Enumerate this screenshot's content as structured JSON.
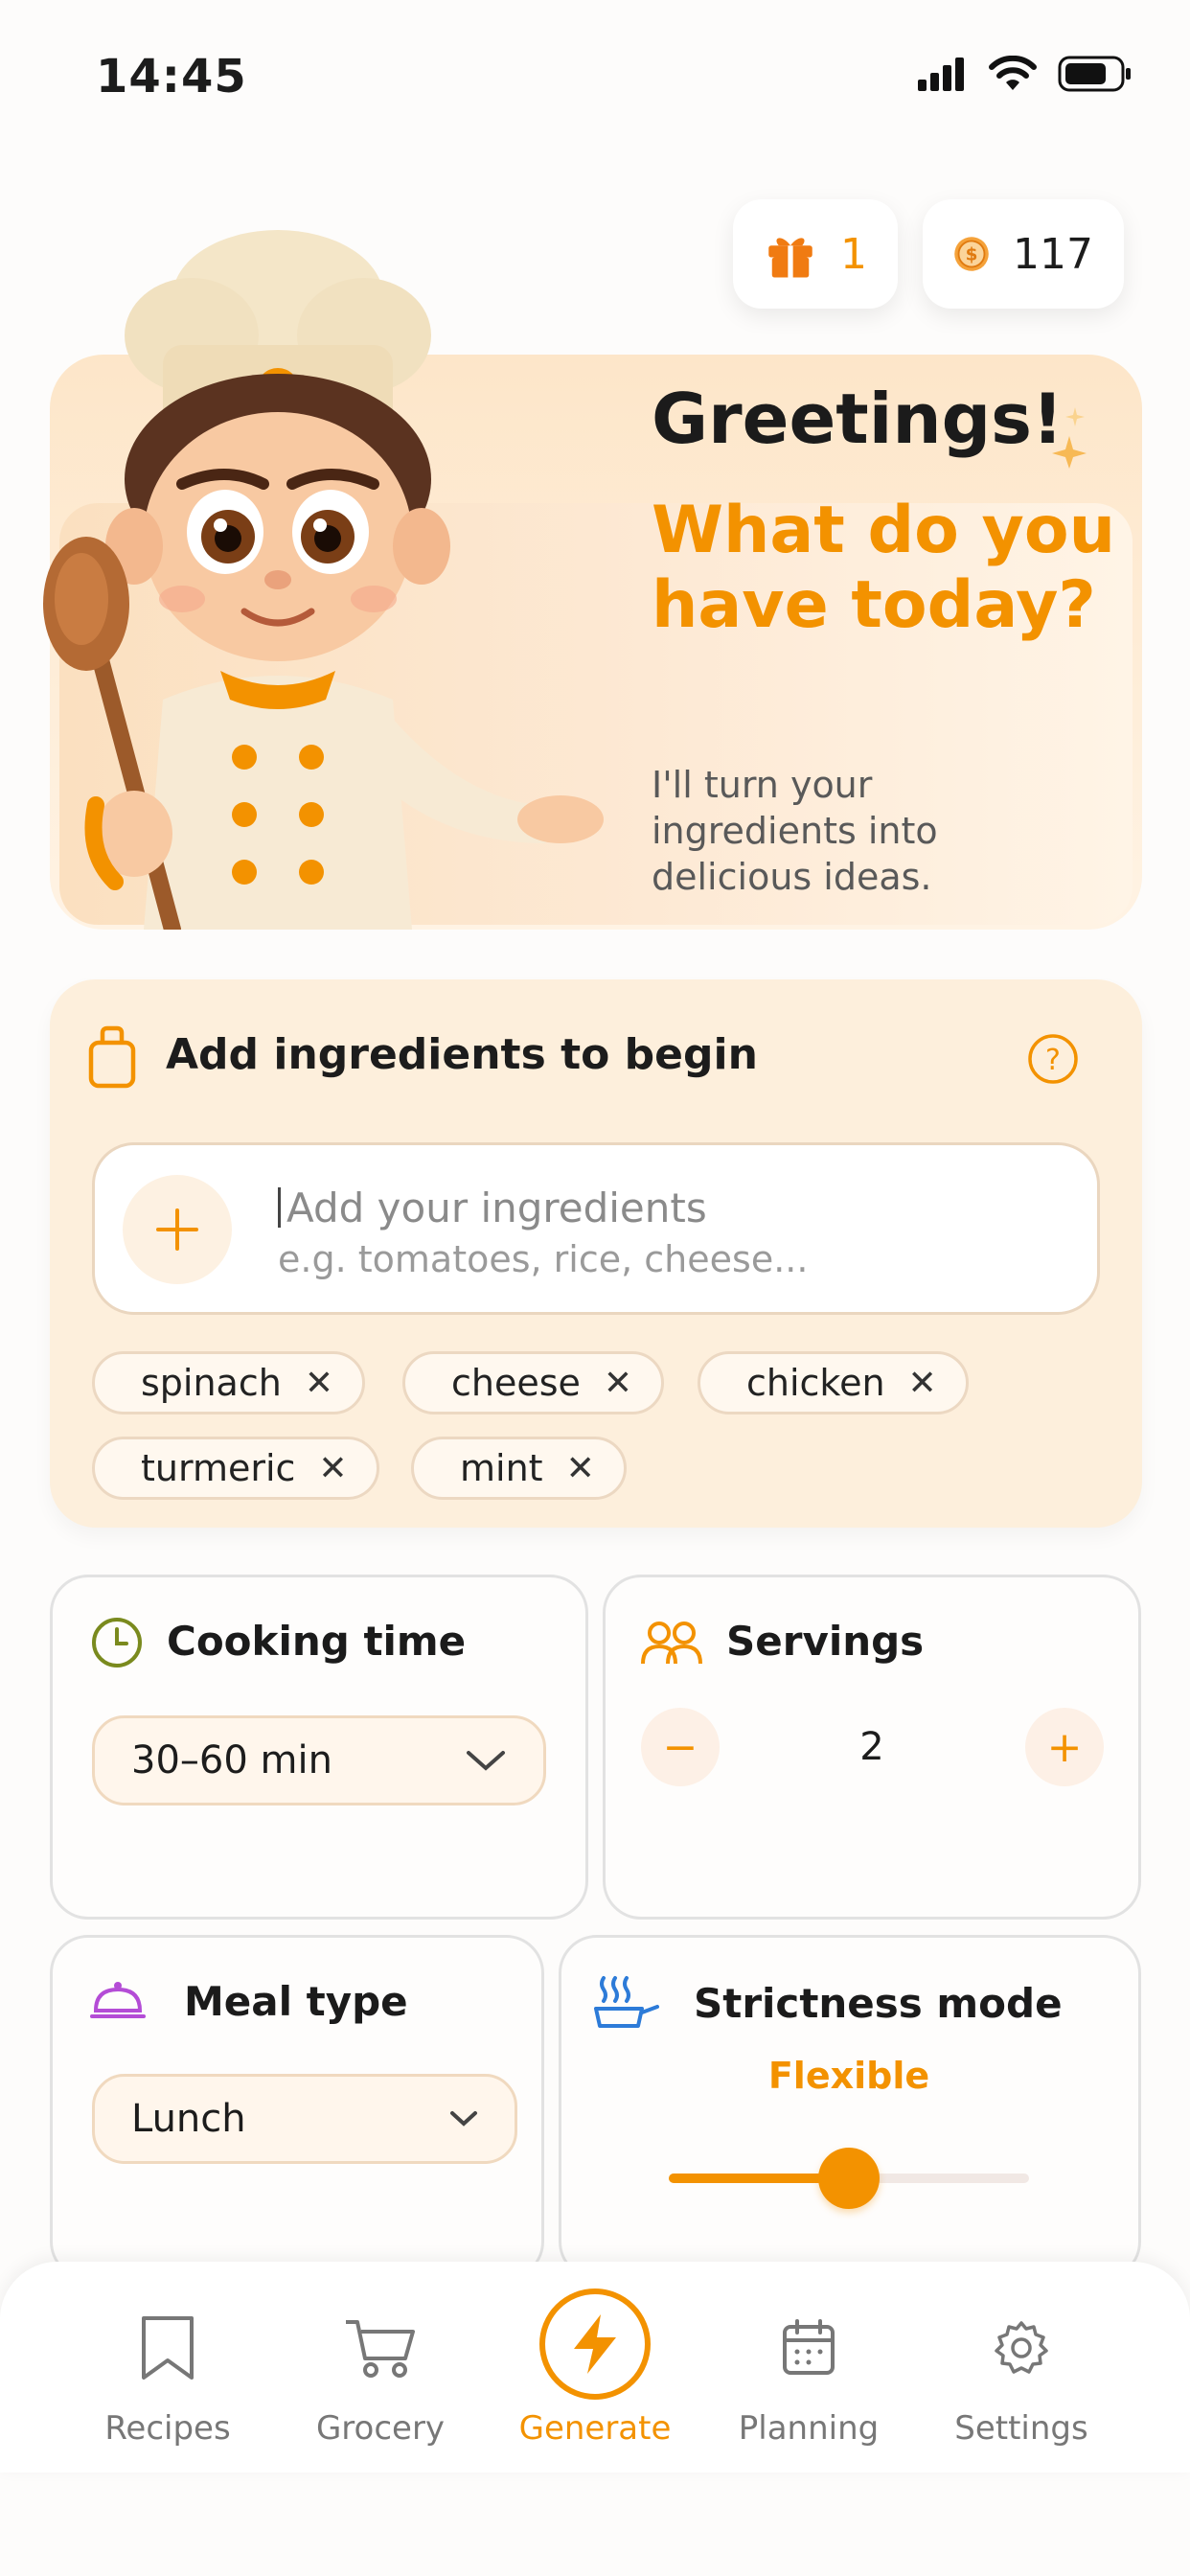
{
  "status_bar": {
    "time": "14:45"
  },
  "rewards": {
    "gifts": "1",
    "coins": "117"
  },
  "hero": {
    "greeting": "Greetings!",
    "question": "What do you have today?",
    "subtitle": "I'll turn your ingredients into delicious ideas."
  },
  "ingredients": {
    "title": "Add ingredients to begin",
    "placeholder": "Add your ingredients",
    "hint": "e.g. tomatoes, rice, cheese...",
    "chips": [
      "spinach",
      "cheese",
      "chicken",
      "turmeric",
      "mint"
    ]
  },
  "cooking_time": {
    "title": "Cooking time",
    "selected": "30–60 min"
  },
  "servings": {
    "title": "Servings",
    "value": "2",
    "minus": "−",
    "plus": "+"
  },
  "meal_type": {
    "title": "Meal type",
    "selected": "Lunch"
  },
  "strictness": {
    "title": "Strictness mode",
    "value": "Flexible",
    "level": 0.5
  },
  "nav": {
    "items": [
      {
        "label": "Recipes",
        "icon": "bookmark-icon"
      },
      {
        "label": "Grocery",
        "icon": "cart-icon"
      },
      {
        "label": "Generate",
        "icon": "lightning-icon",
        "active": true
      },
      {
        "label": "Planning",
        "icon": "calendar-icon"
      },
      {
        "label": "Settings",
        "icon": "gear-icon"
      }
    ]
  },
  "colors": {
    "accent": "#f39200",
    "hero_bg": "#fde6c9",
    "card_bg": "#fdefdc"
  }
}
